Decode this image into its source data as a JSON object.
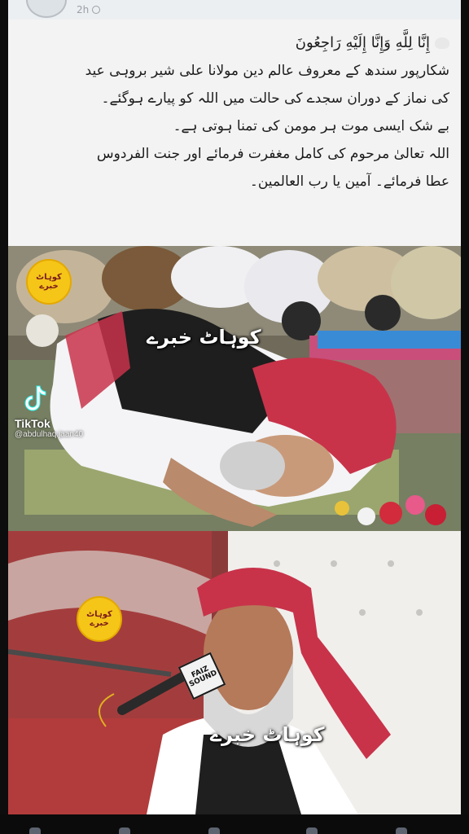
{
  "post": {
    "timestamp": "2h",
    "lines": [
      "إِنَّا لِلَّهِ وَإِنَّا إِلَيْهِ رَاجِعُونَ",
      "شکارپور سندھ کے معروف عالم دین مولانا علی شیر بروہی عید",
      "کی نماز کے دوران سجدے کی حالت میں اللہ کو پیارے ہوگئے۔",
      "بے شک ایسی موت ہر مومن کی تمنا ہوتی ہے۔",
      "اللہ تعالیٰ مرحوم کی کامل مغفرت فرمائے اور جنت الفردوس",
      "عطا فرمائے۔ آمین یا رب العالمین۔"
    ]
  },
  "images": {
    "watermark": "کوہاٹ خبرے",
    "badge_text": "کوہاٹ خبرے",
    "tiktok_label": "TikTok",
    "tiktok_handle": "@abdulhaq.jaan40",
    "mic_label": "FAIZ SOUND"
  },
  "icons": [
    "globe-icon",
    "tiktok-logo-icon"
  ],
  "colors": {
    "badge": "#f5c518",
    "turban": "#c8334a",
    "background": "#f3f3f3"
  }
}
